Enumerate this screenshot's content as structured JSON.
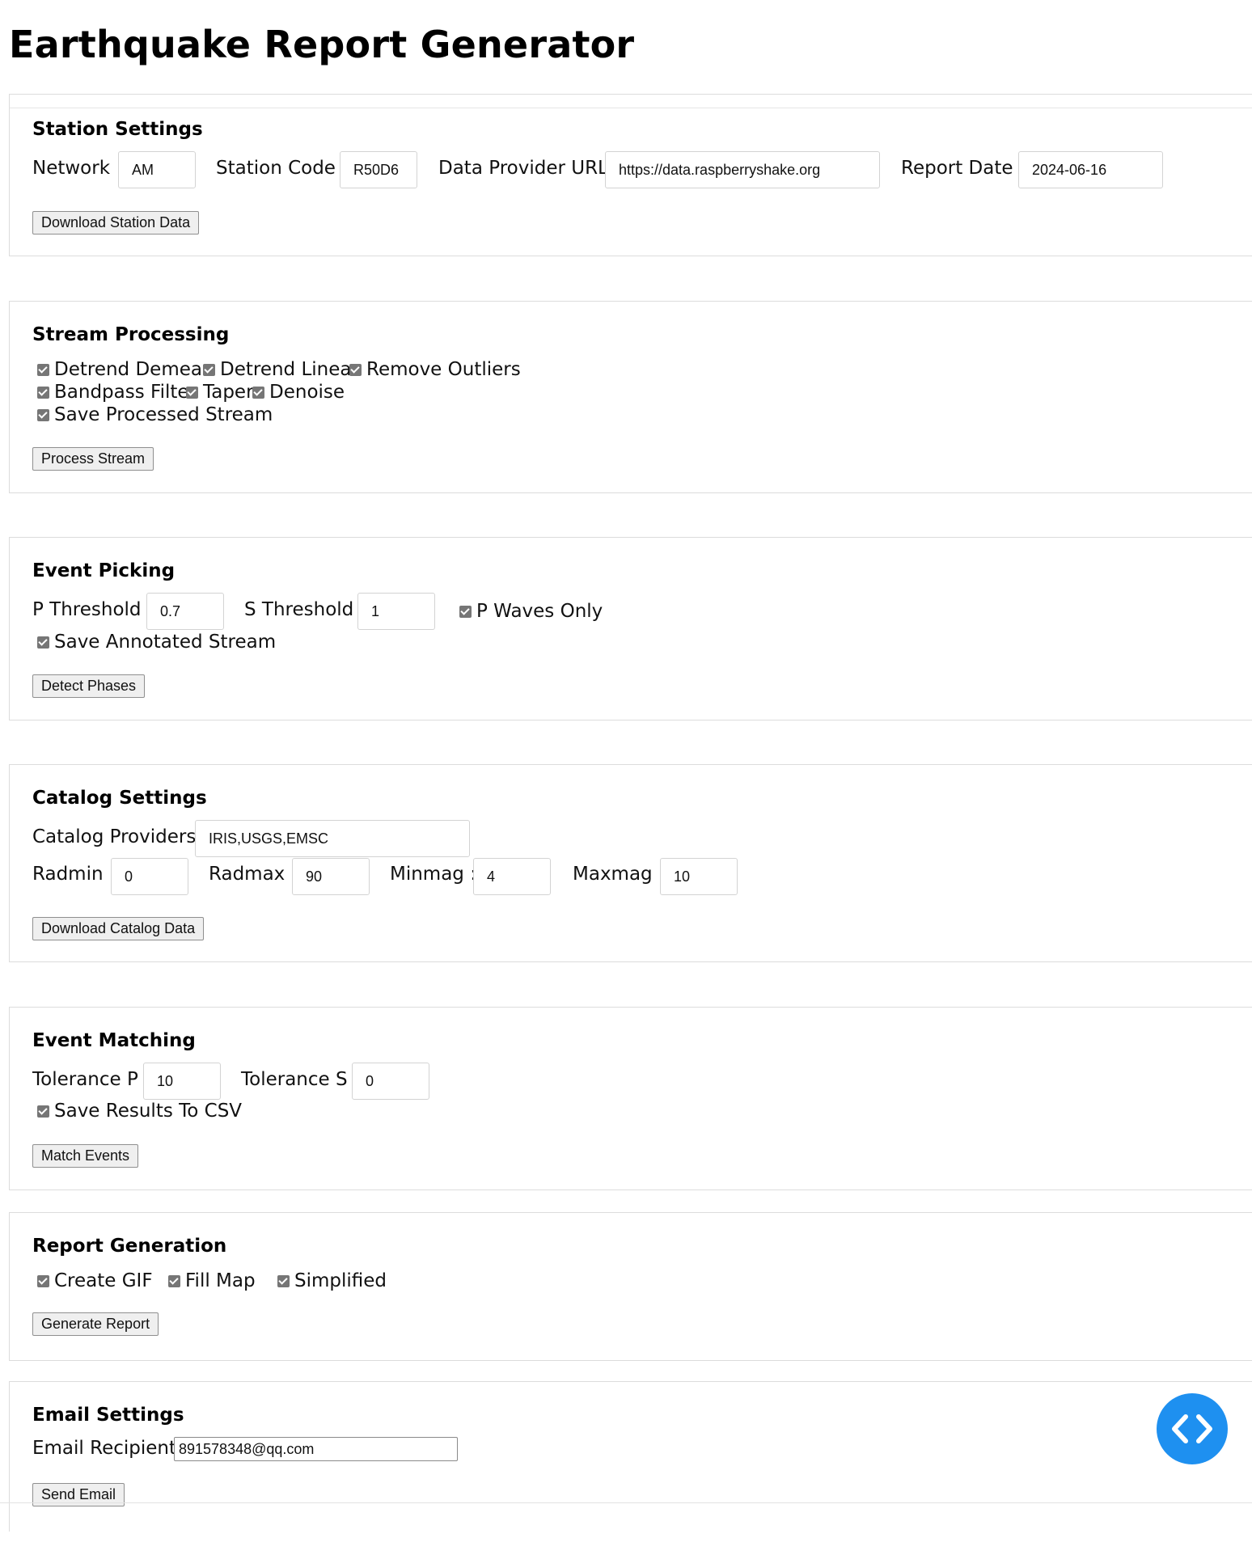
{
  "title": "Earthquake Report Generator",
  "station": {
    "heading": "Station Settings",
    "network_label": "Network :",
    "network": "AM",
    "station_label": "Station Code :",
    "station_code": "R50D6",
    "provider_label": "Data Provider URL :",
    "provider_url": "https://data.raspberryshake.org",
    "date_label": "Report Date :",
    "report_date": "2024-06-16",
    "button": "Download Station Data"
  },
  "stream": {
    "heading": "Stream Processing",
    "options": [
      "Detrend Demean",
      "Detrend Linear",
      "Remove Outliers",
      "Bandpass Filter",
      "Taper",
      "Denoise",
      "Save Processed Stream"
    ],
    "button": "Process Stream"
  },
  "picking": {
    "heading": "Event Picking",
    "p_label": "P Threshold :",
    "p_value": "0.7",
    "s_label": "S Threshold :",
    "s_value": "1",
    "p_only": "P Waves Only",
    "save_annotated": "Save Annotated Stream",
    "button": "Detect Phases"
  },
  "catalog": {
    "heading": "Catalog Settings",
    "providers_label": "Catalog Providers :",
    "providers": "IRIS,USGS,EMSC",
    "radmin_label": "Radmin :",
    "radmin": "0",
    "radmax_label": "Radmax :",
    "radmax": "90",
    "minmag_label": "Minmag :",
    "minmag": "4",
    "maxmag_label": "Maxmag :",
    "maxmag": "10",
    "button": "Download Catalog Data"
  },
  "matching": {
    "heading": "Event Matching",
    "tp_label": "Tolerance P :",
    "tp": "10",
    "ts_label": "Tolerance S :",
    "ts": "0",
    "save_csv": "Save Results To CSV",
    "button": "Match Events"
  },
  "report": {
    "heading": "Report Generation",
    "gif": "Create GIF",
    "fill_map": "Fill Map",
    "simplified": "Simplified",
    "button": "Generate Report"
  },
  "email": {
    "heading": "Email Settings",
    "recipient_label": "Email Recipient :",
    "recipient": "891578348@qq.com",
    "button": "Send Email"
  },
  "colors": {
    "fab": "#1e90f0",
    "border": "#dcdcdc",
    "checkbox": "#767676"
  },
  "fab_icon": "code-icon"
}
